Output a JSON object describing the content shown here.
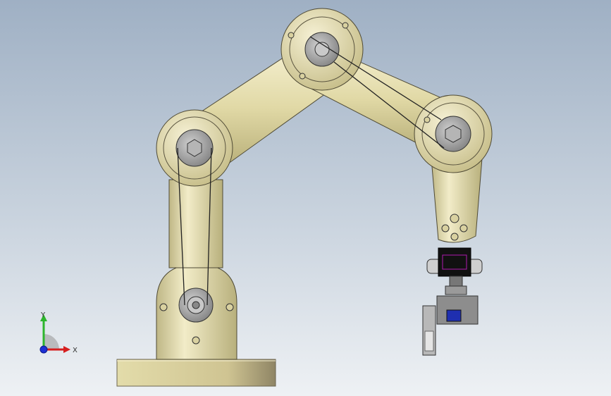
{
  "viewport": {
    "background_top": "#9fb0c4",
    "background_bottom": "#eef1f4"
  },
  "model": {
    "part_color": "#e6dfb0",
    "part_shadow": "#b3ab78",
    "pulley_color": "#9a9a9a",
    "belt_color": "#222222",
    "gripper_body": "#111111",
    "gripper_accent": "#1f2fb0"
  },
  "triad": {
    "x_label": "X",
    "y_label": "Y",
    "x_color": "#d61f1f",
    "y_color": "#2db52d",
    "z_color": "#1c2fd4"
  }
}
